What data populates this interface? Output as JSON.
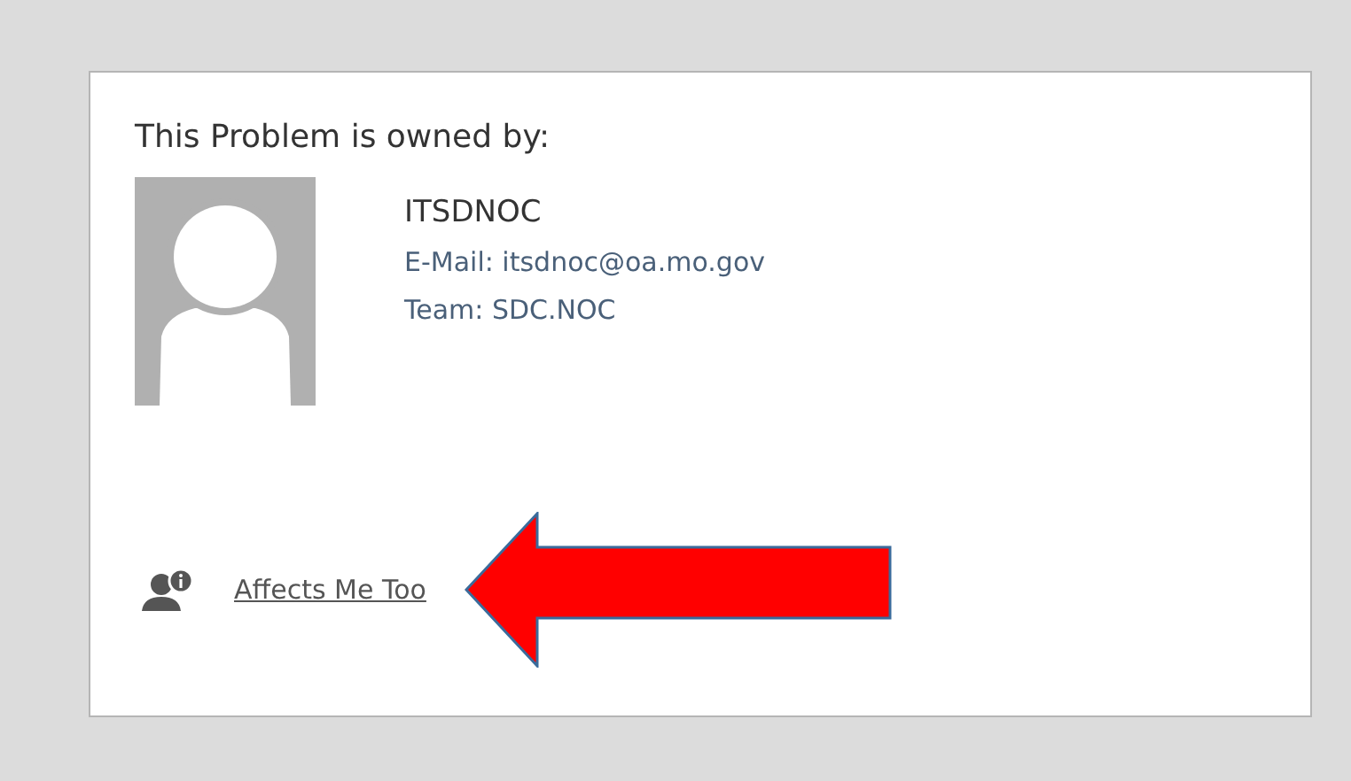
{
  "owner_panel": {
    "heading": "This Problem is owned by:",
    "name": "ITSDNOC",
    "email": "E-Mail: itsdnoc@oa.mo.gov",
    "team": "Team: SDC.NOC"
  },
  "action": {
    "label": "Affects Me Too"
  }
}
